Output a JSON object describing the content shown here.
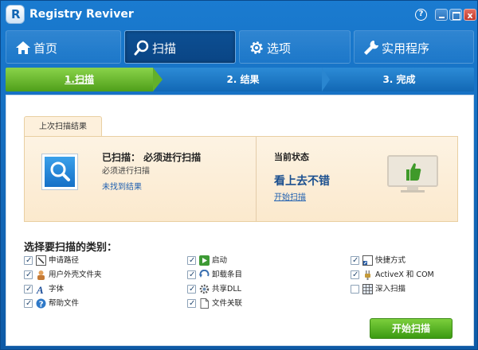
{
  "window": {
    "title": "Registry Reviver",
    "help": "?",
    "close": "x"
  },
  "nav": [
    {
      "label": "首页",
      "icon": "home-icon"
    },
    {
      "label": "扫描",
      "icon": "search-icon"
    },
    {
      "label": "选项",
      "icon": "gear-icon"
    },
    {
      "label": "实用程序",
      "icon": "wrench-icon"
    }
  ],
  "steps": [
    "1.扫描",
    "2. 结果",
    "3. 完成"
  ],
  "last_scan": {
    "tab": "上次扫描结果",
    "scanned": "已扫描：  必须进行扫描",
    "note": "必须进行扫描",
    "link": "未找到结果",
    "state_heading": "当前状态",
    "state_value": "看上去不错",
    "start_link": "开始扫描"
  },
  "categories": {
    "title": "选择要扫描的类别：",
    "items": [
      {
        "label": "申请路径",
        "checked": true,
        "icon": "path-icon"
      },
      {
        "label": "启动",
        "checked": true,
        "icon": "play-icon"
      },
      {
        "label": "快捷方式",
        "checked": true,
        "icon": "shortcut-icon"
      },
      {
        "label": "用户外壳文件夹",
        "checked": true,
        "icon": "user-folder-icon"
      },
      {
        "label": "卸载条目",
        "checked": true,
        "icon": "uninstall-icon"
      },
      {
        "label": "ActiveX 和 COM",
        "checked": true,
        "icon": "plug-icon"
      },
      {
        "label": "字体",
        "checked": true,
        "icon": "font-icon"
      },
      {
        "label": "共享DLL",
        "checked": true,
        "icon": "dll-gear-icon"
      },
      {
        "label": "深入扫描",
        "checked": false,
        "icon": "grid-icon"
      },
      {
        "label": "帮助文件",
        "checked": true,
        "icon": "help-icon"
      },
      {
        "label": "文件关联",
        "checked": true,
        "icon": "file-icon"
      }
    ]
  },
  "start_button": "开始扫描",
  "colors": {
    "accent_green": "#4f9f1a",
    "nav_blue": "#1266b3"
  }
}
